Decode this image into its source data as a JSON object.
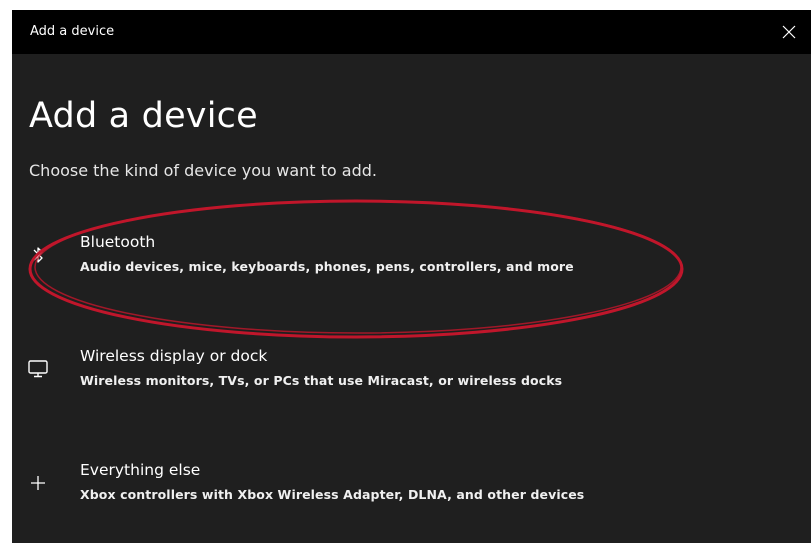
{
  "window": {
    "title": "Add a device",
    "close_icon": "close-icon"
  },
  "main": {
    "heading": "Add a device",
    "subheading": "Choose the kind of device you want to add."
  },
  "options": [
    {
      "icon": "bluetooth-icon",
      "label": "Bluetooth",
      "description": "Audio devices, mice, keyboards, phones, pens, controllers, and more"
    },
    {
      "icon": "monitor-icon",
      "label": "Wireless display or dock",
      "description": "Wireless monitors, TVs, or PCs that use Miracast, or wireless docks"
    },
    {
      "icon": "plus-icon",
      "label": "Everything else",
      "description": "Xbox controllers with Xbox Wireless Adapter, DLNA, and other devices"
    }
  ],
  "colors": {
    "window_bg": "#1f1f1f",
    "titlebar_bg": "#000000",
    "annotation": "#c0162b"
  }
}
